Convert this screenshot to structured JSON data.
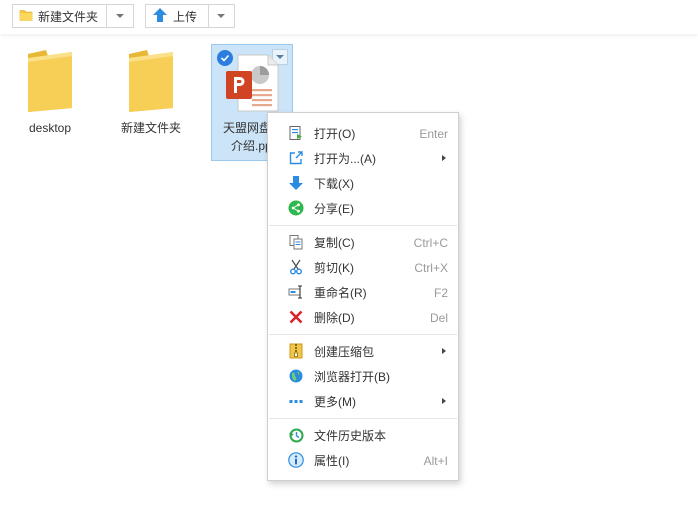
{
  "toolbar": {
    "new_folder_label": "新建文件夹",
    "upload_label": "上传"
  },
  "files": [
    {
      "name": "desktop",
      "type": "folder"
    },
    {
      "name": "新建文件夹",
      "type": "folder"
    },
    {
      "name_line1": "天盟网盘产",
      "name_line2": "介绍.ppt",
      "type": "ppt",
      "selected": true
    }
  ],
  "context_menu": {
    "groups": [
      [
        {
          "label": "打开(O)",
          "shortcut": "Enter",
          "icon": "open-icon"
        },
        {
          "label": "打开为...(A)",
          "shortcut": "",
          "icon": "open-as-icon",
          "submenu": true
        },
        {
          "label": "下载(X)",
          "shortcut": "",
          "icon": "download-icon"
        },
        {
          "label": "分享(E)",
          "shortcut": "",
          "icon": "share-icon"
        }
      ],
      [
        {
          "label": "复制(C)",
          "shortcut": "Ctrl+C",
          "icon": "copy-icon"
        },
        {
          "label": "剪切(K)",
          "shortcut": "Ctrl+X",
          "icon": "cut-icon"
        },
        {
          "label": "重命名(R)",
          "shortcut": "F2",
          "icon": "rename-icon"
        },
        {
          "label": "删除(D)",
          "shortcut": "Del",
          "icon": "delete-icon"
        }
      ],
      [
        {
          "label": "创建压缩包",
          "shortcut": "",
          "icon": "zip-icon",
          "submenu": true
        },
        {
          "label": "浏览器打开(B)",
          "shortcut": "",
          "icon": "browser-icon"
        },
        {
          "label": "更多(M)",
          "shortcut": "",
          "icon": "more-icon",
          "submenu": true
        }
      ],
      [
        {
          "label": "文件历史版本",
          "shortcut": "",
          "icon": "history-icon"
        },
        {
          "label": "属性(I)",
          "shortcut": "Alt+I",
          "icon": "info-icon"
        }
      ]
    ]
  },
  "colors": {
    "folder": "#f5c93f",
    "selection_bg": "#cce4f7",
    "accent_blue": "#2b7de0",
    "ppt_red": "#d04423"
  }
}
